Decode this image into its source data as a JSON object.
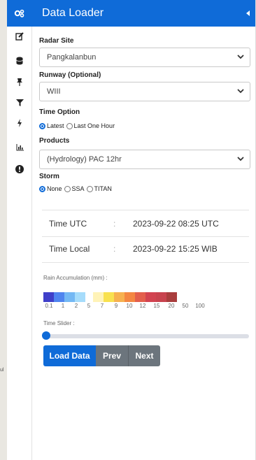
{
  "map": {
    "edge_label": "ul"
  },
  "rail": {
    "icons": [
      "gears-icon",
      "edit-icon",
      "database-icon",
      "pin-icon",
      "filter-icon",
      "bolt-icon",
      "bar-chart-icon",
      "info-icon"
    ]
  },
  "panel": {
    "title": "Data Loader"
  },
  "radar": {
    "label": "Radar Site",
    "value": "Pangkalanbun"
  },
  "runway": {
    "label": "Runway (Optional)",
    "value": "WIII"
  },
  "time_option": {
    "label": "Time Option",
    "options": [
      "Latest",
      "Last One Hour"
    ],
    "selected": "Latest"
  },
  "products": {
    "label": "Products",
    "value": "(Hydrology) PAC 12hr"
  },
  "storm": {
    "label": "Storm",
    "options": [
      "None",
      "SSA",
      "TITAN"
    ],
    "selected": "None"
  },
  "time_utc": {
    "label": "Time UTC",
    "sep": ":",
    "value": "2023-09-22 08:25 UTC"
  },
  "time_local": {
    "label": "Time Local",
    "sep": ":",
    "value": "2023-09-22 15:25 WIB"
  },
  "legend": {
    "title": "Rain Accumulation (mm) :",
    "colors": [
      "#3f3fc9",
      "#4f84ef",
      "#74b8f4",
      "#a6dcfb",
      "#ffffff",
      "#fff3b8",
      "#f8e14f",
      "#f7b14f",
      "#f48742",
      "#e35f4c",
      "#d24350",
      "#c8434e",
      "#a93d3d"
    ],
    "ticks": [
      "0.1",
      "1",
      "2",
      "5",
      "7",
      "9",
      "10",
      "12",
      "15",
      "20",
      "50",
      "100"
    ]
  },
  "slider": {
    "label": "Time Slider :",
    "value": 0
  },
  "buttons": {
    "load": "Load Data",
    "prev": "Prev",
    "next": "Next"
  }
}
